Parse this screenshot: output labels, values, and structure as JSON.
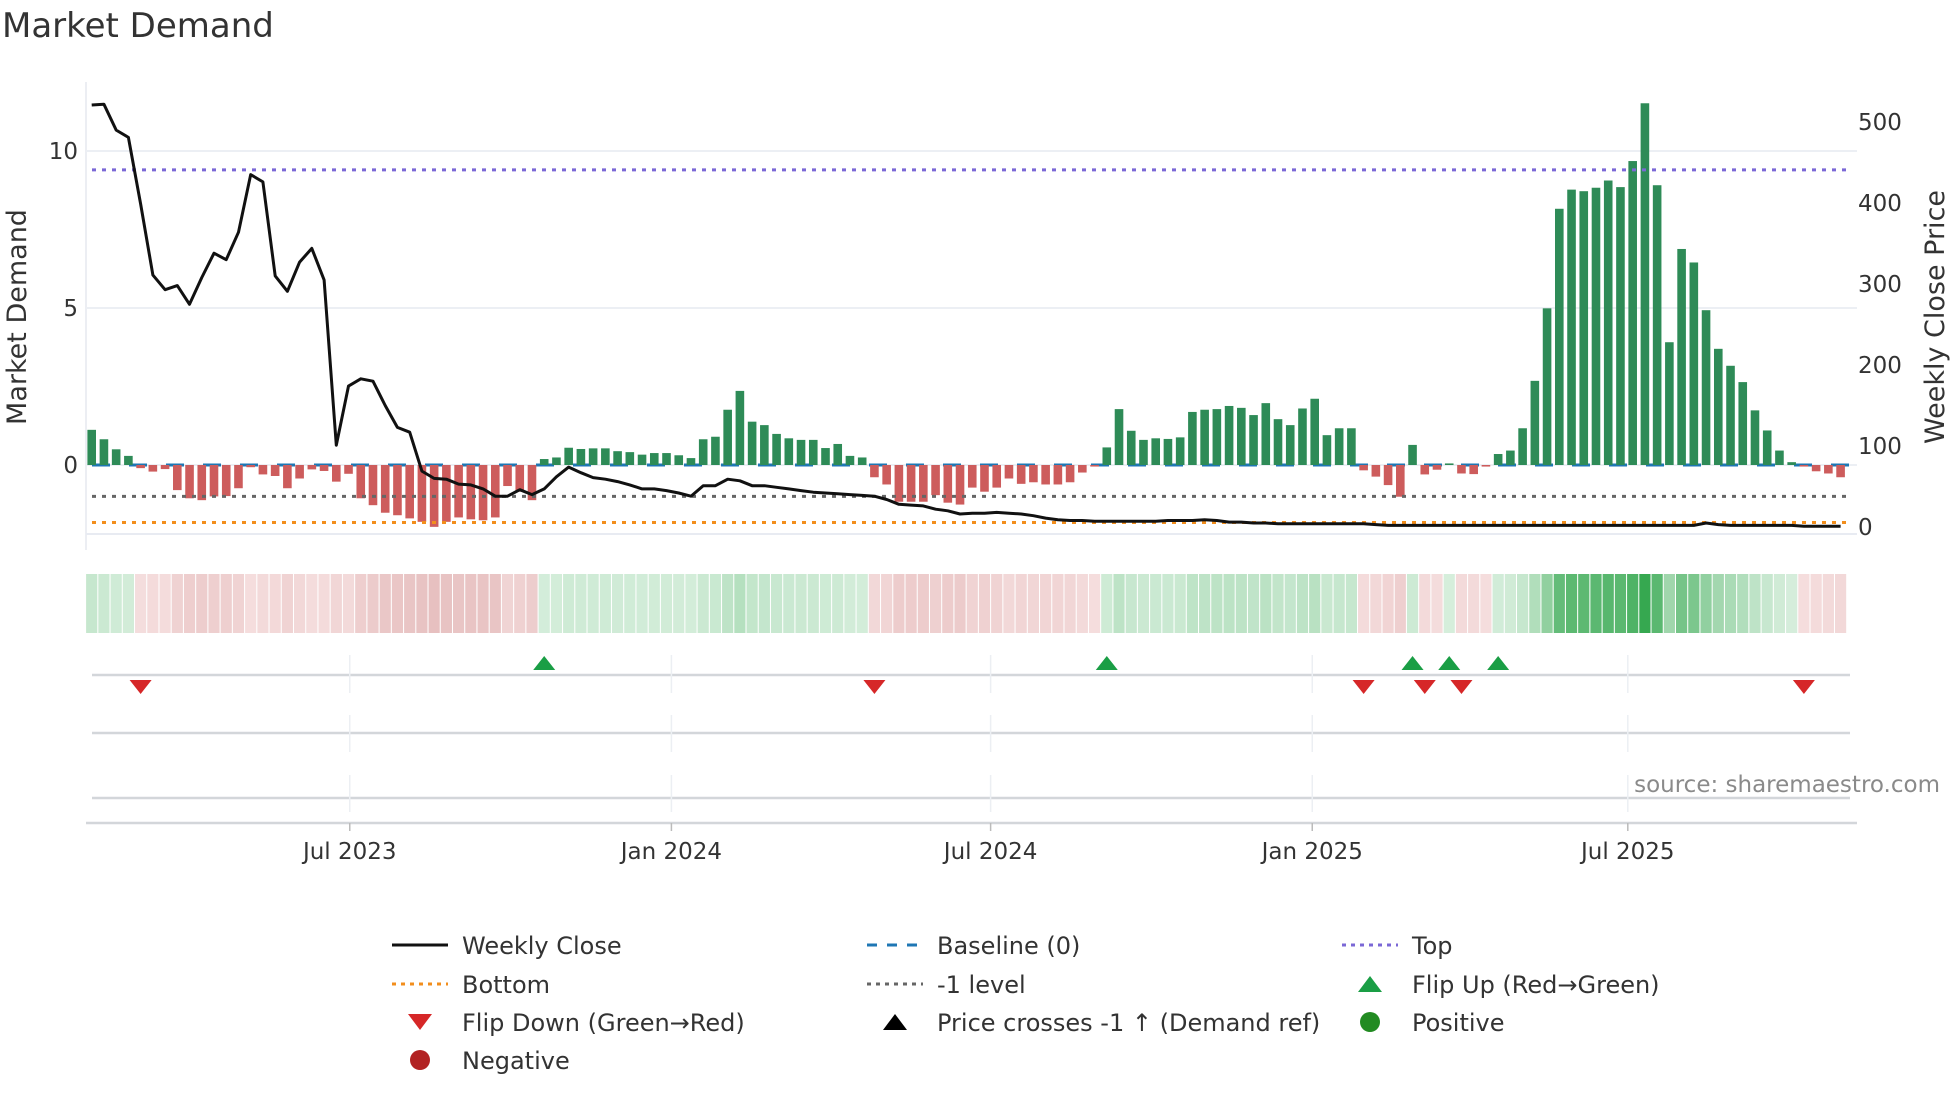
{
  "chart_data": {
    "type": "bar",
    "title": "Market Demand",
    "ylabel": "Market Demand",
    "y2label": "Weekly Close Price",
    "ylim": [
      -2.3,
      12.5
    ],
    "y2lim": [
      0,
      520
    ],
    "yticks": [
      0,
      5,
      10
    ],
    "y2ticks": [
      0,
      100,
      200,
      300,
      400,
      500
    ],
    "x_ticks": [
      {
        "label": "Jul 2023",
        "week": 21.1
      },
      {
        "label": "Jan 2024",
        "week": 47.4
      },
      {
        "label": "Jul 2024",
        "week": 73.5
      },
      {
        "label": "Jan 2025",
        "week": 99.8
      },
      {
        "label": "Jul 2025",
        "week": 125.6
      }
    ],
    "levels": {
      "baseline": 0,
      "top": 9.4,
      "minus_one": -1,
      "bottom": -1.83
    },
    "demand": [
      1.12,
      0.82,
      0.5,
      0.29,
      -0.1,
      -0.21,
      -0.13,
      -0.8,
      -1.06,
      -1.12,
      -1.0,
      -0.99,
      -0.74,
      -0.07,
      -0.3,
      -0.35,
      -0.74,
      -0.43,
      -0.14,
      -0.19,
      -0.53,
      -0.28,
      -1.06,
      -1.28,
      -1.52,
      -1.6,
      -1.7,
      -1.81,
      -1.97,
      -1.81,
      -1.67,
      -1.73,
      -1.76,
      -1.67,
      -0.67,
      -0.85,
      -1.12,
      0.19,
      0.24,
      0.55,
      0.51,
      0.53,
      0.53,
      0.44,
      0.41,
      0.33,
      0.38,
      0.38,
      0.31,
      0.22,
      0.82,
      0.9,
      1.76,
      2.36,
      1.38,
      1.27,
      0.99,
      0.85,
      0.8,
      0.8,
      0.54,
      0.67,
      0.29,
      0.24,
      -0.39,
      -0.62,
      -1.17,
      -1.17,
      -1.17,
      -0.96,
      -1.2,
      -1.26,
      -0.72,
      -0.85,
      -0.72,
      -0.43,
      -0.6,
      -0.55,
      -0.62,
      -0.62,
      -0.55,
      -0.24,
      -0.05,
      0.56,
      1.78,
      1.09,
      0.8,
      0.85,
      0.83,
      0.88,
      1.69,
      1.76,
      1.78,
      1.88,
      1.82,
      1.59,
      1.97,
      1.46,
      1.27,
      1.8,
      2.11,
      0.95,
      1.17,
      1.17,
      -0.17,
      -0.37,
      -0.64,
      -1.01,
      0.64,
      -0.3,
      -0.15,
      0.05,
      -0.27,
      -0.29,
      -0.05,
      0.35,
      0.46,
      1.17,
      2.68,
      4.99,
      8.16,
      8.77,
      8.72,
      8.83,
      9.06,
      8.85,
      9.68,
      11.52,
      8.91,
      3.91,
      6.88,
      6.45,
      4.93,
      3.7,
      3.16,
      2.64,
      1.74,
      1.1,
      0.46,
      0.09,
      -0.05,
      -0.2,
      -0.27,
      -0.39
    ],
    "weekly_close": [
      521,
      522,
      490,
      481,
      399,
      311,
      293,
      298,
      275,
      308,
      338,
      330,
      364,
      435,
      426,
      310,
      291,
      327,
      344,
      305,
      101,
      174,
      183,
      180,
      150,
      123,
      117,
      69,
      60,
      59,
      53,
      52,
      47,
      38,
      38,
      46,
      40,
      47,
      62,
      74,
      67,
      61,
      59,
      56,
      52,
      47,
      47,
      45,
      42,
      38,
      51,
      51,
      59,
      57,
      51,
      51,
      49,
      47,
      45,
      43,
      42,
      41,
      40,
      39,
      38,
      34,
      28,
      27,
      26,
      22,
      20,
      16,
      17,
      17,
      18,
      17,
      16,
      14,
      11,
      9,
      8,
      8,
      7,
      7,
      7,
      7,
      7,
      7,
      8,
      8,
      8,
      9,
      8,
      6,
      6,
      5,
      5,
      4,
      4,
      4,
      4,
      4,
      4,
      4,
      4,
      3,
      2,
      2,
      2,
      2,
      2,
      2,
      2,
      2,
      2,
      2,
      2,
      2,
      2,
      2,
      2,
      2,
      2,
      2,
      2,
      2,
      2,
      2,
      2,
      2,
      2,
      2,
      5,
      3,
      2,
      2,
      2,
      2,
      2,
      2,
      1,
      1,
      1,
      1
    ],
    "flip_up_weeks": [
      37,
      83,
      108,
      111,
      115
    ],
    "flip_down_weeks": [
      4,
      64,
      104,
      109,
      112,
      140
    ],
    "legend": [
      {
        "label": "Weekly Close",
        "kind": "line",
        "color": "#111111",
        "dash": ""
      },
      {
        "label": "Baseline (0)",
        "kind": "line",
        "color": "#1f77b4",
        "dash": "10 10"
      },
      {
        "label": "Top",
        "kind": "line",
        "color": "#7b68d6",
        "dash": "4 5"
      },
      {
        "label": "Bottom",
        "kind": "line",
        "color": "#f28e1c",
        "dash": "4 5"
      },
      {
        "label": "-1 level",
        "kind": "line",
        "color": "#666666",
        "dash": "4 5"
      },
      {
        "label": "Flip Up (Red→Green)",
        "kind": "up",
        "color": "#1a9e45"
      },
      {
        "label": "Flip Down (Green→Red)",
        "kind": "down",
        "color": "#d62728"
      },
      {
        "label": "Price crosses -1 ↑ (Demand ref)",
        "kind": "up",
        "color": "#000000"
      },
      {
        "label": "Positive",
        "kind": "dot",
        "color": "#228b22"
      },
      {
        "label": "Negative",
        "kind": "dot",
        "color": "#b22222"
      }
    ],
    "source": "source: sharemaestro.com",
    "colors": {
      "positive": "#2e8b57",
      "negative": "#cd5c5c",
      "price": "#111111"
    }
  }
}
